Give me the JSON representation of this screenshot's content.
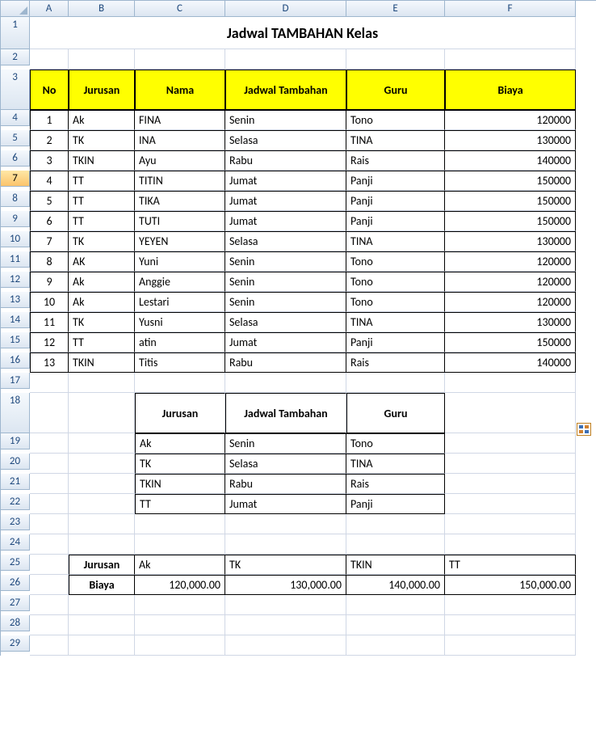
{
  "columns": [
    "A",
    "B",
    "C",
    "D",
    "E",
    "F"
  ],
  "row_numbers": [
    1,
    2,
    3,
    4,
    5,
    6,
    7,
    8,
    9,
    10,
    11,
    12,
    13,
    14,
    15,
    16,
    17,
    18,
    19,
    20,
    21,
    22,
    23,
    24,
    25,
    26,
    27,
    28,
    29
  ],
  "selected_row": 7,
  "title": "Jadwal TAMBAHAN Kelas",
  "main_table": {
    "headers": [
      "No",
      "Jurusan",
      "Nama",
      "Jadwal Tambahan",
      "Guru",
      "Biaya"
    ],
    "rows": [
      {
        "no": 1,
        "jurusan": "Ak",
        "nama": "FINA",
        "jadwal": "Senin",
        "guru": "Tono",
        "biaya": "120000"
      },
      {
        "no": 2,
        "jurusan": "TK",
        "nama": "INA",
        "jadwal": "Selasa",
        "guru": "TINA",
        "biaya": "130000"
      },
      {
        "no": 3,
        "jurusan": "TKIN",
        "nama": "Ayu",
        "jadwal": "Rabu",
        "guru": "Rais",
        "biaya": "140000"
      },
      {
        "no": 4,
        "jurusan": "TT",
        "nama": "TITIN",
        "jadwal": "Jumat",
        "guru": "Panji",
        "biaya": "150000"
      },
      {
        "no": 5,
        "jurusan": "TT",
        "nama": "TIKA",
        "jadwal": "Jumat",
        "guru": "Panji",
        "biaya": "150000"
      },
      {
        "no": 6,
        "jurusan": "TT",
        "nama": "TUTI",
        "jadwal": "Jumat",
        "guru": "Panji",
        "biaya": "150000"
      },
      {
        "no": 7,
        "jurusan": "TK",
        "nama": "YEYEN",
        "jadwal": "Selasa",
        "guru": "TINA",
        "biaya": "130000"
      },
      {
        "no": 8,
        "jurusan": "AK",
        "nama": "Yuni",
        "jadwal": "Senin",
        "guru": "Tono",
        "biaya": "120000"
      },
      {
        "no": 9,
        "jurusan": "Ak",
        "nama": "Anggie",
        "jadwal": "Senin",
        "guru": "Tono",
        "biaya": "120000"
      },
      {
        "no": 10,
        "jurusan": "Ak",
        "nama": "Lestari",
        "jadwal": "Senin",
        "guru": "Tono",
        "biaya": "120000"
      },
      {
        "no": 11,
        "jurusan": "TK",
        "nama": "Yusni",
        "jadwal": "Selasa",
        "guru": "TINA",
        "biaya": "130000"
      },
      {
        "no": 12,
        "jurusan": "TT",
        "nama": "atin",
        "jadwal": "Jumat",
        "guru": "Panji",
        "biaya": "150000"
      },
      {
        "no": 13,
        "jurusan": "TKIN",
        "nama": "Titis",
        "jadwal": "Rabu",
        "guru": "Rais",
        "biaya": "140000"
      }
    ]
  },
  "lookup_table": {
    "headers": [
      "Jurusan",
      "Jadwal Tambahan",
      "Guru"
    ],
    "rows": [
      {
        "jurusan": "Ak",
        "jadwal": "Senin",
        "guru": "Tono"
      },
      {
        "jurusan": "TK",
        "jadwal": "Selasa",
        "guru": "TINA"
      },
      {
        "jurusan": "TKIN",
        "jadwal": "Rabu",
        "guru": "Rais"
      },
      {
        "jurusan": "TT",
        "jadwal": "Jumat",
        "guru": "Panji"
      }
    ]
  },
  "hlookup_table": {
    "label_jurusan": "Jurusan",
    "label_biaya": "Biaya",
    "cols": [
      {
        "jurusan": "Ak",
        "biaya": "120,000.00"
      },
      {
        "jurusan": "TK",
        "biaya": "130,000.00"
      },
      {
        "jurusan": "TKIN",
        "biaya": "140,000.00"
      },
      {
        "jurusan": "TT",
        "biaya": "150,000.00"
      }
    ]
  },
  "chart_data": {
    "type": "table",
    "title": "Jadwal TAMBAHAN Kelas",
    "columns": [
      "No",
      "Jurusan",
      "Nama",
      "Jadwal Tambahan",
      "Guru",
      "Biaya"
    ],
    "rows": [
      [
        1,
        "Ak",
        "FINA",
        "Senin",
        "Tono",
        120000
      ],
      [
        2,
        "TK",
        "INA",
        "Selasa",
        "TINA",
        130000
      ],
      [
        3,
        "TKIN",
        "Ayu",
        "Rabu",
        "Rais",
        140000
      ],
      [
        4,
        "TT",
        "TITIN",
        "Jumat",
        "Panji",
        150000
      ],
      [
        5,
        "TT",
        "TIKA",
        "Jumat",
        "Panji",
        150000
      ],
      [
        6,
        "TT",
        "TUTI",
        "Jumat",
        "Panji",
        150000
      ],
      [
        7,
        "TK",
        "YEYEN",
        "Selasa",
        "TINA",
        130000
      ],
      [
        8,
        "AK",
        "Yuni",
        "Senin",
        "Tono",
        120000
      ],
      [
        9,
        "Ak",
        "Anggie",
        "Senin",
        "Tono",
        120000
      ],
      [
        10,
        "Ak",
        "Lestari",
        "Senin",
        "Tono",
        120000
      ],
      [
        11,
        "TK",
        "Yusni",
        "Selasa",
        "TINA",
        130000
      ],
      [
        12,
        "TT",
        "atin",
        "Jumat",
        "Panji",
        150000
      ],
      [
        13,
        "TKIN",
        "Titis",
        "Rabu",
        "Rais",
        140000
      ]
    ]
  }
}
